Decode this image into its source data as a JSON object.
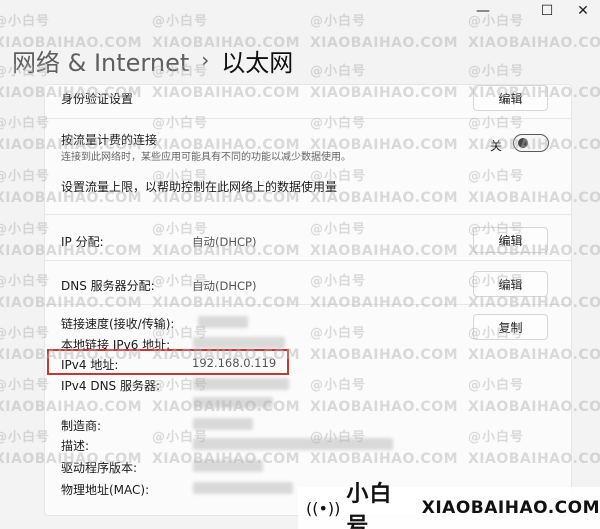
{
  "window": {
    "minimize_glyph": "—",
    "maximize_glyph": "☐",
    "close_glyph": "✕"
  },
  "header": {
    "parent": "网络 & Internet",
    "separator": "›",
    "current": "以太网"
  },
  "settings": {
    "auth": {
      "label": "身份验证设置",
      "button": "编辑"
    },
    "metered": {
      "label": "按流量计费的连接",
      "description": "连接到此网络时，某些应用可能具有不同的功能以减少数据使用。",
      "toggle_state": "关",
      "toggle_on": false
    },
    "data_limit_link": "设置流量上限，以帮助控制在此网络上的数据使用量",
    "ip_assignment": {
      "label": "IP 分配:",
      "value": "自动(DHCP)",
      "button": "编辑"
    },
    "dns_assignment": {
      "label": "DNS 服务器分配:",
      "value": "自动(DHCP)",
      "button": "编辑"
    },
    "properties": {
      "copy_button": "复制",
      "rows": [
        {
          "label": "链接速度(接收/传输):",
          "value": ""
        },
        {
          "label": "本地链接 IPv6 地址:",
          "value": ""
        },
        {
          "label": "IPv4 地址:",
          "value": "192.168.0.119"
        },
        {
          "label": "IPv4 DNS 服务器:",
          "value": ""
        },
        {
          "label": "制造商:",
          "value": ""
        },
        {
          "label": "描述:",
          "value": ""
        },
        {
          "label": "驱动程序版本:",
          "value": ""
        },
        {
          "label": "物理地址(MAC):",
          "value": ""
        }
      ]
    }
  },
  "watermark": {
    "tile_cn": "@小白号",
    "tile_en": "XIAOBAIHAO.COM",
    "brand_icon": "signal-icon",
    "brand_cn": "小白号",
    "brand_en": "XIAOBAIHAO.COM"
  },
  "colors": {
    "highlight": "#c9352f",
    "background": "#f3f3f3",
    "panel": "#fbfbfb"
  }
}
